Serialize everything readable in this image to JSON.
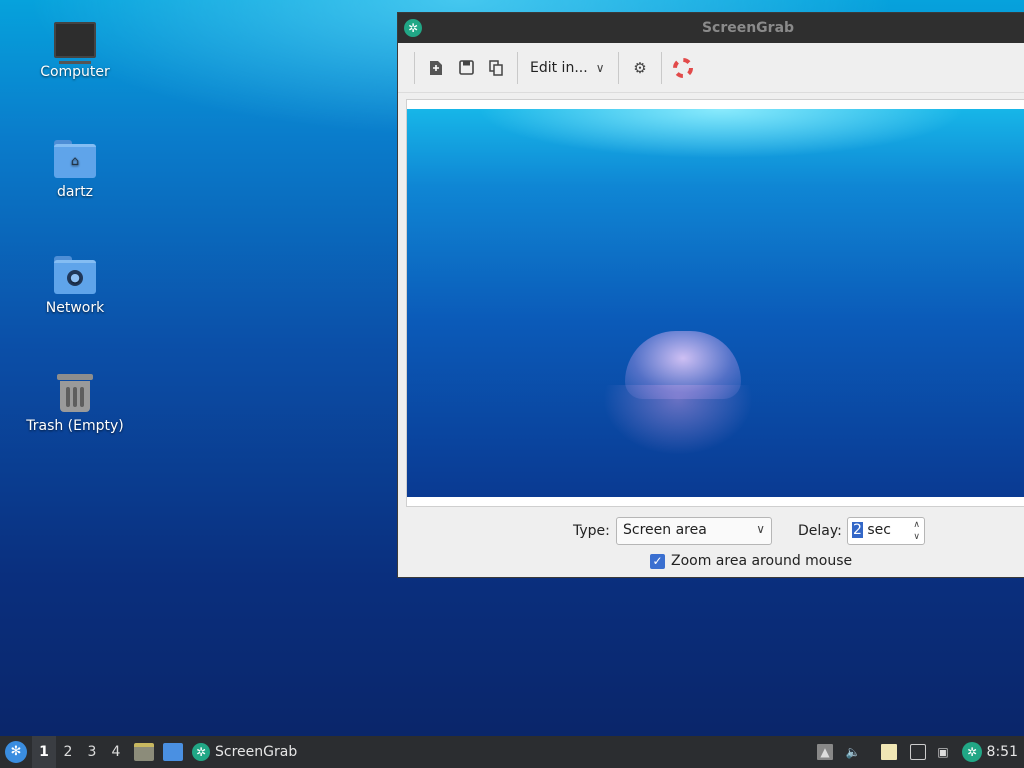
{
  "desktop": {
    "icons": [
      {
        "label": "Computer",
        "icon": "computer-icon"
      },
      {
        "label": "dartz",
        "icon": "home-folder-icon"
      },
      {
        "label": "Network",
        "icon": "network-folder-icon"
      },
      {
        "label": "Trash (Empty)",
        "icon": "trash-icon"
      }
    ]
  },
  "window": {
    "title": "ScreenGrab",
    "toolbar": {
      "new_icon": "new-screenshot-icon",
      "save_icon": "save-icon",
      "copy_icon": "copy-icon",
      "edit_label": "Edit in...",
      "settings_icon": "gear-icon",
      "help_icon": "help-lifebuoy-icon"
    },
    "controls": {
      "type_label": "Type:",
      "type_value": "Screen area",
      "delay_label": "Delay:",
      "delay_value": "2",
      "delay_unit": " sec",
      "zoom_label": "Zoom area around mouse",
      "zoom_checked": true
    }
  },
  "taskbar": {
    "workspaces": [
      "1",
      "2",
      "3",
      "4"
    ],
    "active_workspace": "1",
    "task_label": "ScreenGrab",
    "clock": "8:51"
  },
  "colors": {
    "accent": "#3367c7",
    "app_green": "#21a786",
    "taskbar_bg": "#2b2d30",
    "titlebar_bg": "#2f2f2f"
  }
}
